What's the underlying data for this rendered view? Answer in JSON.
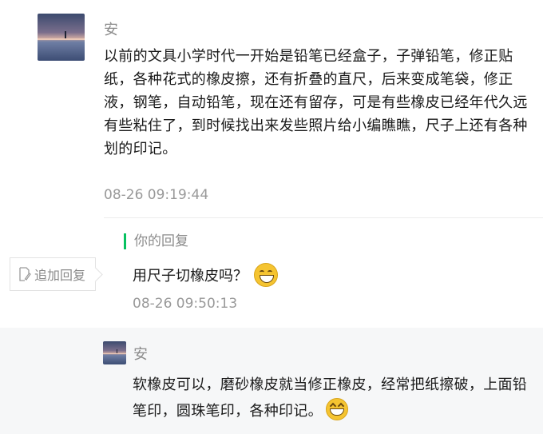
{
  "comment": {
    "author": "安",
    "text": "以前的文具小学时代一开始是铅笔已经盒子，子弹铅笔，修正贴纸，各种花式的橡皮擦，还有折叠的直尺，后来变成笔袋，修正液，钢笔，自动铅笔，现在还有留存，可是有些橡皮已经年代久远有些粘住了，到时候找出来发些照片给小编瞧瞧，尺子上还有各种划的印记。",
    "time": "08-26 09:19:44"
  },
  "reply": {
    "label": "你的回复",
    "text": "用尺子切橡皮吗？",
    "time": "08-26 09:50:13",
    "add_reply_label": "追加回复",
    "emoji": "grinning-face"
  },
  "sub_reply": {
    "author": "安",
    "text": "软橡皮可以，磨砂橡皮就当修正橡皮，经常把纸擦破，上面铅笔印，圆珠笔印，各种印记。",
    "emoji": "grinning-squinting-face"
  },
  "colors": {
    "accent": "#07c160",
    "meta_text": "#999999",
    "panel_bg": "#f6f7f8"
  }
}
